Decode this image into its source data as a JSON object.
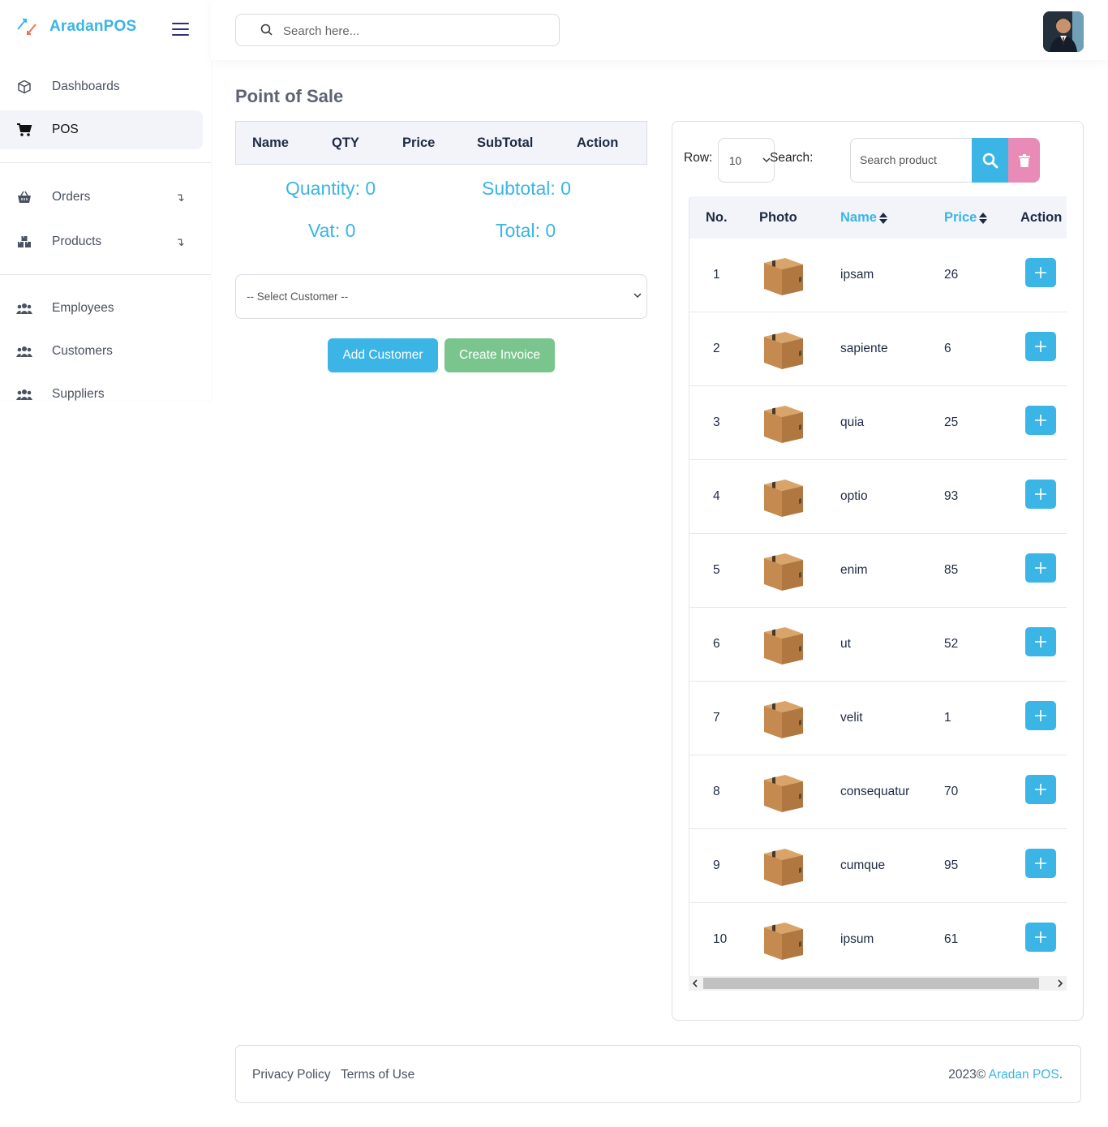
{
  "brand": {
    "name": "AradanPOS"
  },
  "topbar": {
    "search_placeholder": "Search here..."
  },
  "sidebar": {
    "items": [
      {
        "label": "Dashboards",
        "icon": "cube-icon"
      },
      {
        "label": "POS",
        "icon": "cart-icon",
        "active": true
      },
      {
        "label": "Orders",
        "icon": "basket-icon",
        "submenu": true
      },
      {
        "label": "Products",
        "icon": "boxes-icon",
        "submenu": true
      },
      {
        "label": "Employees",
        "icon": "users-icon"
      },
      {
        "label": "Customers",
        "icon": "users-icon"
      },
      {
        "label": "Suppliers",
        "icon": "users-icon"
      }
    ],
    "submenu_arrow": "↴"
  },
  "page": {
    "title": "Point of Sale"
  },
  "cart": {
    "headers": [
      "Name",
      "QTY",
      "Price",
      "SubTotal",
      "Action"
    ],
    "quantity": "Quantity: 0",
    "subtotal": "Subtotal: 0",
    "vat": "Vat: 0",
    "total": "Total: 0",
    "customer_select": "-- Select Customer --",
    "add_customer": "Add Customer",
    "create_invoice": "Create Invoice"
  },
  "products": {
    "row_label": "Row:",
    "row_value": "10",
    "search_label": "Search:",
    "search_placeholder": "Search product",
    "headers": {
      "no": "No.",
      "photo": "Photo",
      "name": "Name",
      "price": "Price",
      "action": "Action"
    },
    "rows": [
      {
        "no": "1",
        "name": "ipsam",
        "price": "26"
      },
      {
        "no": "2",
        "name": "sapiente",
        "price": "6"
      },
      {
        "no": "3",
        "name": "quia",
        "price": "25"
      },
      {
        "no": "4",
        "name": "optio",
        "price": "93"
      },
      {
        "no": "5",
        "name": "enim",
        "price": "85"
      },
      {
        "no": "6",
        "name": "ut",
        "price": "52"
      },
      {
        "no": "7",
        "name": "velit",
        "price": "1"
      },
      {
        "no": "8",
        "name": "consequatur",
        "price": "70"
      },
      {
        "no": "9",
        "name": "cumque",
        "price": "95"
      },
      {
        "no": "10",
        "name": "ipsum",
        "price": "61"
      }
    ]
  },
  "footer": {
    "privacy": "Privacy Policy",
    "terms": "Terms of Use",
    "copyright": "2023©",
    "brand": "Aradan POS",
    "period": "."
  },
  "colors": {
    "accent": "#3ab5e6",
    "success": "#7ac58e",
    "danger": "#e88bb6",
    "heading": "#1e2a44"
  }
}
